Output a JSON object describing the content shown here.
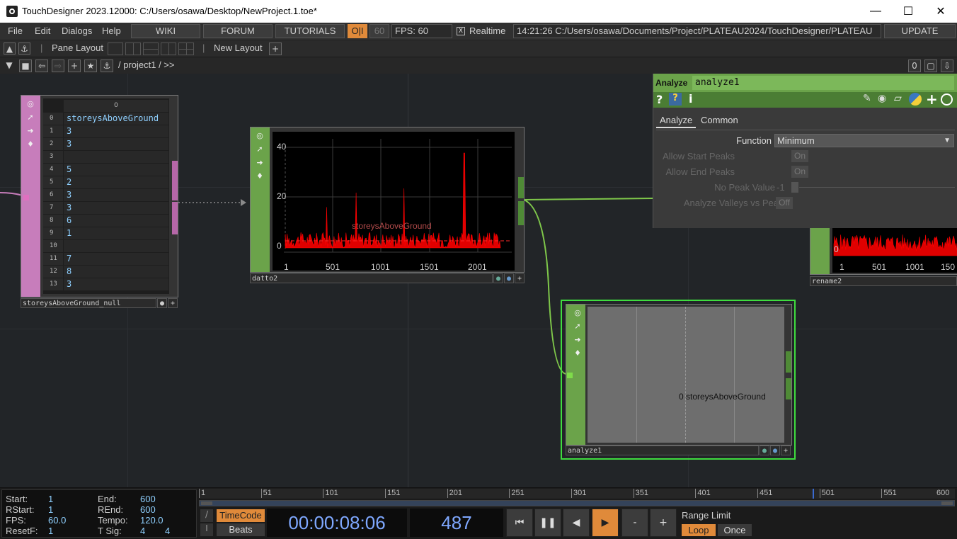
{
  "window": {
    "title": "TouchDesigner 2023.12000: C:/Users/osawa/Desktop/NewProject.1.toe*"
  },
  "menu": {
    "file": "File",
    "edit": "Edit",
    "dialogs": "Dialogs",
    "help": "Help",
    "wiki": "WIKI",
    "forum": "FORUM",
    "tutorials": "TUTORIALS",
    "oi": "O|I",
    "fps_box": "60",
    "fps_label": "FPS:  60",
    "realtime_check": "X",
    "realtime": "Realtime",
    "status": "14:21:26 C:/Users/osawa/Documents/Project/PLATEAU2024/TouchDesigner/PLATEAU",
    "update": "UPDATE"
  },
  "toolbar": {
    "pane_layout": "Pane Layout",
    "new_layout": "New Layout",
    "plus": "+"
  },
  "pathbar": {
    "path": "/ project1 / >>",
    "right_value": "0"
  },
  "table_op": {
    "header": "0",
    "rows": [
      {
        "i": "0",
        "v": "storeysAboveGround"
      },
      {
        "i": "1",
        "v": "3"
      },
      {
        "i": "2",
        "v": "3"
      },
      {
        "i": "3",
        "v": ""
      },
      {
        "i": "4",
        "v": "5"
      },
      {
        "i": "5",
        "v": "2"
      },
      {
        "i": "6",
        "v": "3"
      },
      {
        "i": "7",
        "v": "3"
      },
      {
        "i": "8",
        "v": "6"
      },
      {
        "i": "9",
        "v": "1"
      },
      {
        "i": "10",
        "v": ""
      },
      {
        "i": "11",
        "v": "7"
      },
      {
        "i": "12",
        "v": "8"
      },
      {
        "i": "13",
        "v": "3"
      }
    ],
    "name": "storeysAboveGround_null"
  },
  "datto_op": {
    "name": "datto2",
    "chart_label": "storeysAboveGround",
    "y_ticks": [
      "40",
      "20",
      "0"
    ],
    "x_ticks": [
      "1",
      "501",
      "1001",
      "1501",
      "2001"
    ]
  },
  "rename_op": {
    "name": "rename2",
    "x_ticks": [
      "1",
      "501",
      "1001",
      "150"
    ],
    "y_tick": "0"
  },
  "analyze_op": {
    "name": "analyze1",
    "label": "0 storeysAboveGround"
  },
  "params": {
    "type": "Analyze",
    "name": "analyze1",
    "tabs": [
      "Analyze",
      "Common"
    ],
    "function_label": "Function",
    "function_value": "Minimum",
    "allow_start_peaks": "Allow Start Peaks",
    "allow_end_peaks": "Allow End Peaks",
    "no_peak_value": "No Peak Value",
    "no_peak_num": "-1",
    "valleys": "Analyze Valleys vs Peaks",
    "on": "On",
    "off": "Off"
  },
  "timeline": {
    "start_label": "Start:",
    "start": "1",
    "end_label": "End:",
    "end": "600",
    "rstart_label": "RStart:",
    "rstart": "1",
    "rend_label": "REnd:",
    "rend": "600",
    "fps_label": "FPS:",
    "fps": "60.0",
    "tempo_label": "Tempo:",
    "tempo": "120.0",
    "resetf_label": "ResetF:",
    "resetf": "1",
    "tsig_label": "T Sig:",
    "tsig_a": "4",
    "tsig_b": "4",
    "ruler": [
      "1",
      "51",
      "101",
      "151",
      "201",
      "251",
      "301",
      "351",
      "401",
      "451",
      "501",
      "551",
      "600"
    ],
    "timecode_btn": "TimeCode",
    "beats_btn": "Beats",
    "timecode": "00:00:08:06",
    "frame": "487",
    "range_limit": "Range Limit",
    "loop": "Loop",
    "once": "Once"
  },
  "colors": {
    "dat": "#c77dbb",
    "chop": "#6ba34a",
    "accent": "#e08a3a",
    "wire": "#7fc84a"
  }
}
